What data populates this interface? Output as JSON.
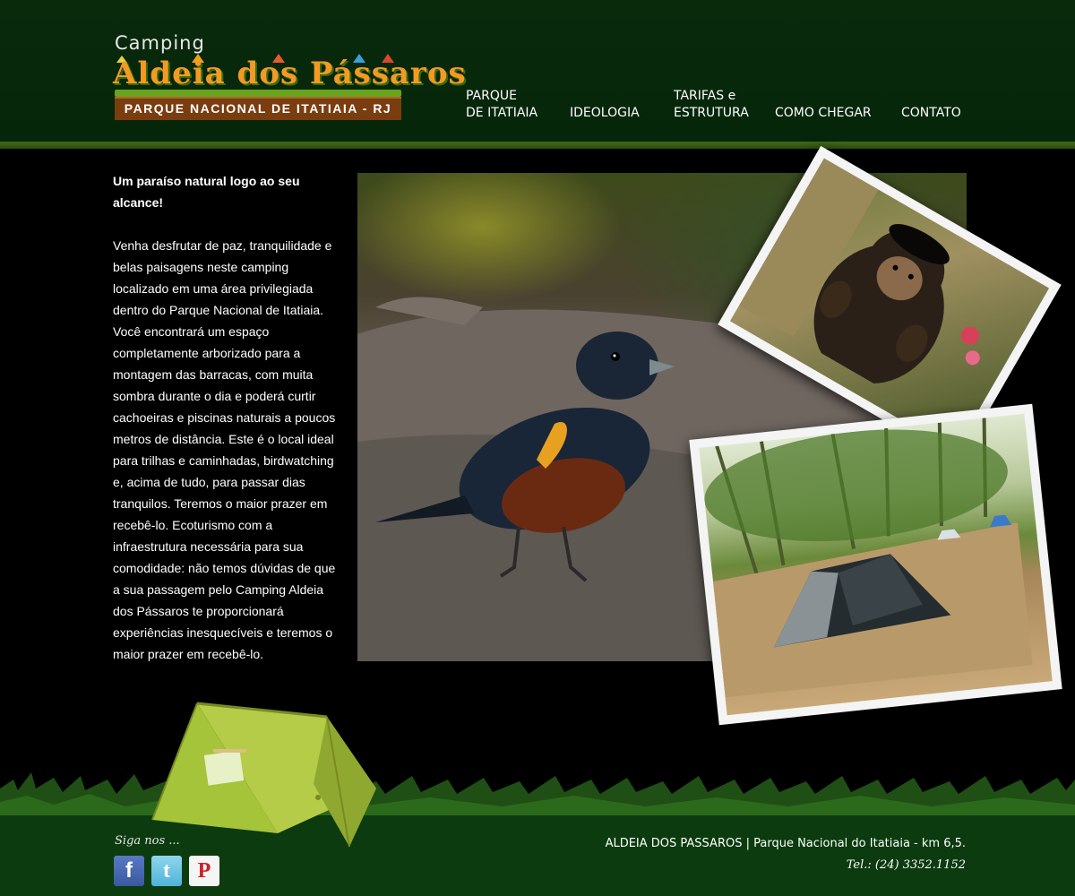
{
  "logo": {
    "top_line": "Camping",
    "name": "Aldeia dos Pássaros",
    "banner": "PARQUE NACIONAL DE ITATIAIA - RJ"
  },
  "nav": [
    {
      "line1": "PARQUE",
      "line2": "DE ITATIAIA"
    },
    {
      "line1": "",
      "line2": "IDEOLOGIA"
    },
    {
      "line1": "TARIFAS e",
      "line2": "ESTRUTURA"
    },
    {
      "line1": "",
      "line2": "COMO CHEGAR"
    },
    {
      "line1": "",
      "line2": "CONTATO"
    }
  ],
  "intro": {
    "title": "Um paraíso natural logo ao seu alcance!",
    "body": "Venha desfrutar de paz, tranquilidade e belas paisagens neste camping localizado em uma área privilegiada dentro do Parque Nacional de Itatiaia. Você encontrará um espaço completamente arborizado para a montagem das barracas, com muita sombra durante o dia e poderá curtir cachoeiras e piscinas naturais a poucos metros de distância. Este é o local ideal para trilhas e caminhadas, birdwatching e, acima de tudo, para passar dias tranquilos. Teremos o maior prazer em recebê-lo. Ecoturismo com a infraestrutura necessária para sua comodidade:  não temos dúvidas de que a sua passagem pelo Camping Aldeia dos Pássaros te proporcionará experiências inesquecíveis e teremos o maior prazer em recebê-lo."
  },
  "footer": {
    "follow_label": "Siga nos ...",
    "social": [
      {
        "name": "facebook-icon",
        "glyph": "f"
      },
      {
        "name": "twitter-icon",
        "glyph": "t"
      },
      {
        "name": "pinterest-icon",
        "glyph": "P"
      }
    ],
    "address": "ALDEIA DOS PASSAROS  |  Parque Nacional do Itatiaia - km 6,5.",
    "phone": "Tel.: (24) 3352.1152"
  },
  "colors": {
    "header_bg": "#05260a",
    "stripe": "#3f6a18",
    "footer_bg": "#0b3b0e",
    "logo_orange": "#f29a24",
    "banner_brown": "#7a3d10",
    "tent_green": "#a6c43a"
  }
}
